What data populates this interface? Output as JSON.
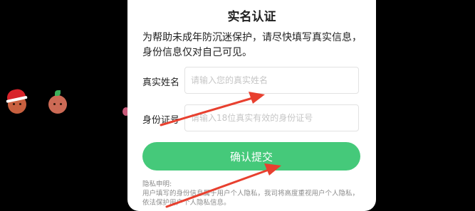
{
  "dialog": {
    "title": "实名认证",
    "description": "为帮助未成年防沉迷保护，请尽快填写真实信息，身份信息仅对自己可见。",
    "name_label": "真实姓名",
    "name_placeholder": "请输入您的真实姓名",
    "id_label": "身份证号",
    "id_placeholder": "请输入18位真实有效的身份证号",
    "confirm_label": "确认提交",
    "privacy_title": "隐私申明:",
    "privacy_text": "用户填写的身份信息属于用户个人隐私，我司将高度重视用户个人隐私，依法保护用户个人隐私信息。"
  },
  "colors": {
    "confirm_button": "#45c97a",
    "annotation_arrow": "#e8402f"
  }
}
